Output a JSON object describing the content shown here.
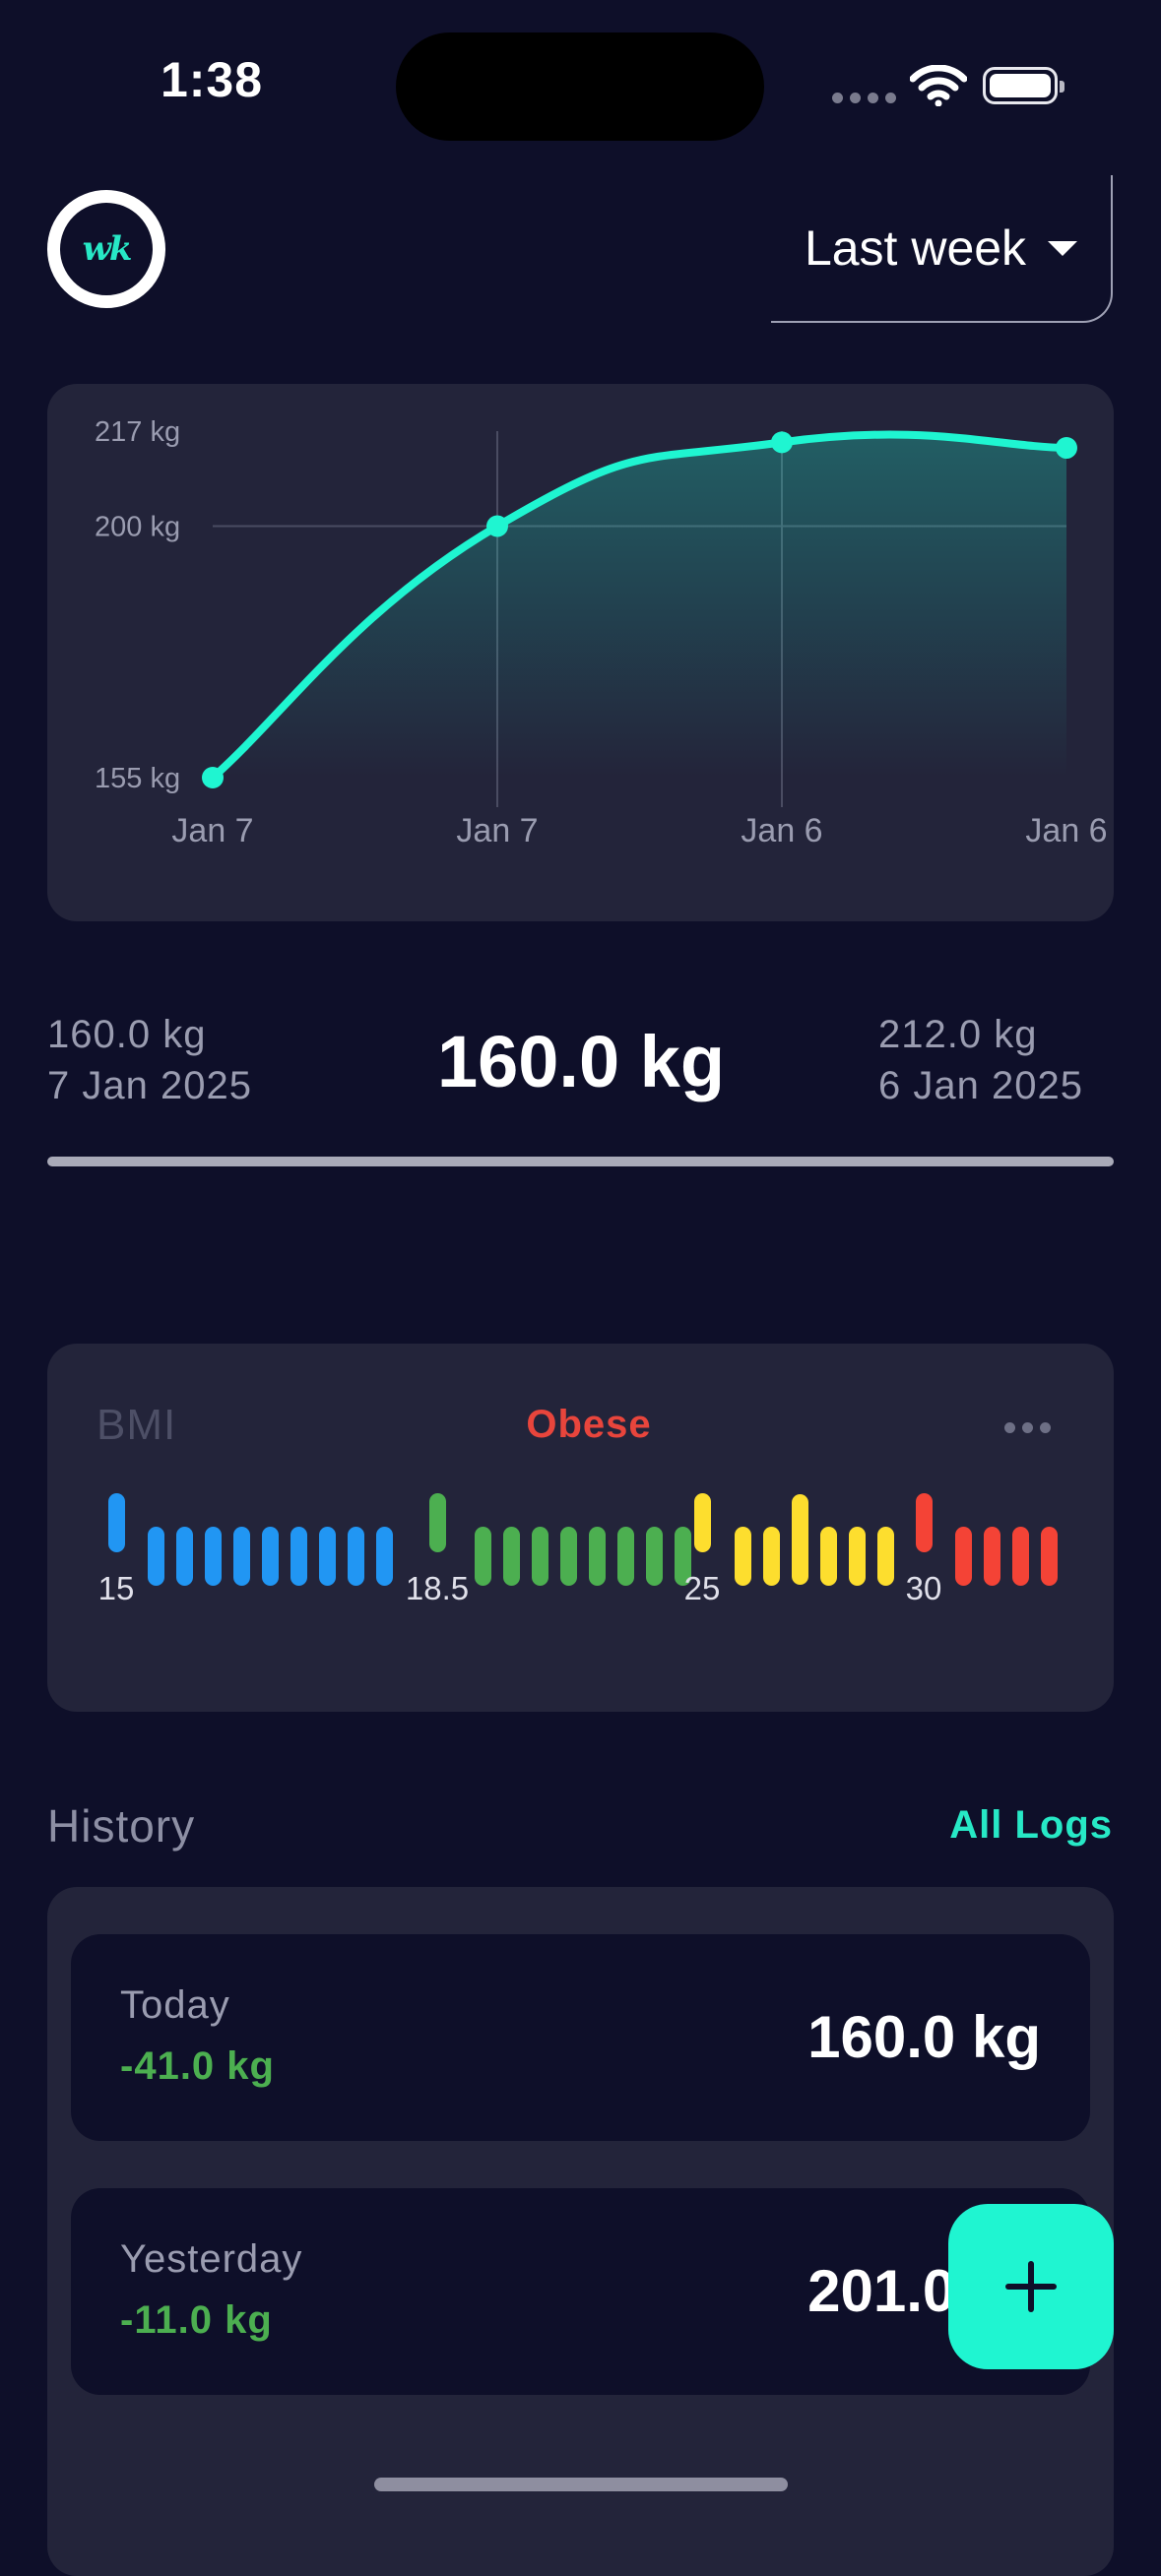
{
  "status_bar": {
    "time": "1:38"
  },
  "header": {
    "logo_text": "wk",
    "period_label": "Last week"
  },
  "chart_data": {
    "type": "area",
    "x": [
      "Jan 7",
      "Jan 7",
      "Jan 6",
      "Jan 6"
    ],
    "values": [
      155,
      200,
      215,
      214
    ],
    "y_tick_labels": [
      "217 kg",
      "200 kg",
      "155 kg"
    ],
    "y_ticks": [
      217,
      200,
      155
    ],
    "ylim": [
      155,
      217
    ],
    "color": "#1ff5d1",
    "grid": true
  },
  "summary": {
    "left_weight": "160.0 kg",
    "left_date": "7 Jan 2025",
    "current_weight": "160.0 kg",
    "right_weight": "212.0 kg",
    "right_date": "6 Jan 2025"
  },
  "bmi": {
    "title": "BMI",
    "status": "Obese",
    "status_color": "#e8453c",
    "ticks": [
      "15",
      "18.5",
      "25",
      "30"
    ],
    "scale_colors": [
      "#2196f3",
      "#4caf50",
      "#fdde2e",
      "#f44336"
    ]
  },
  "history": {
    "title": "History",
    "all_logs_label": "All Logs",
    "entries": [
      {
        "day": "Today",
        "change": "-41.0 kg",
        "weight": "160.0 kg"
      },
      {
        "day": "Yesterday",
        "change": "-11.0 kg",
        "weight": "201.0 kg"
      }
    ]
  },
  "fab": {
    "icon": "plus-icon"
  }
}
